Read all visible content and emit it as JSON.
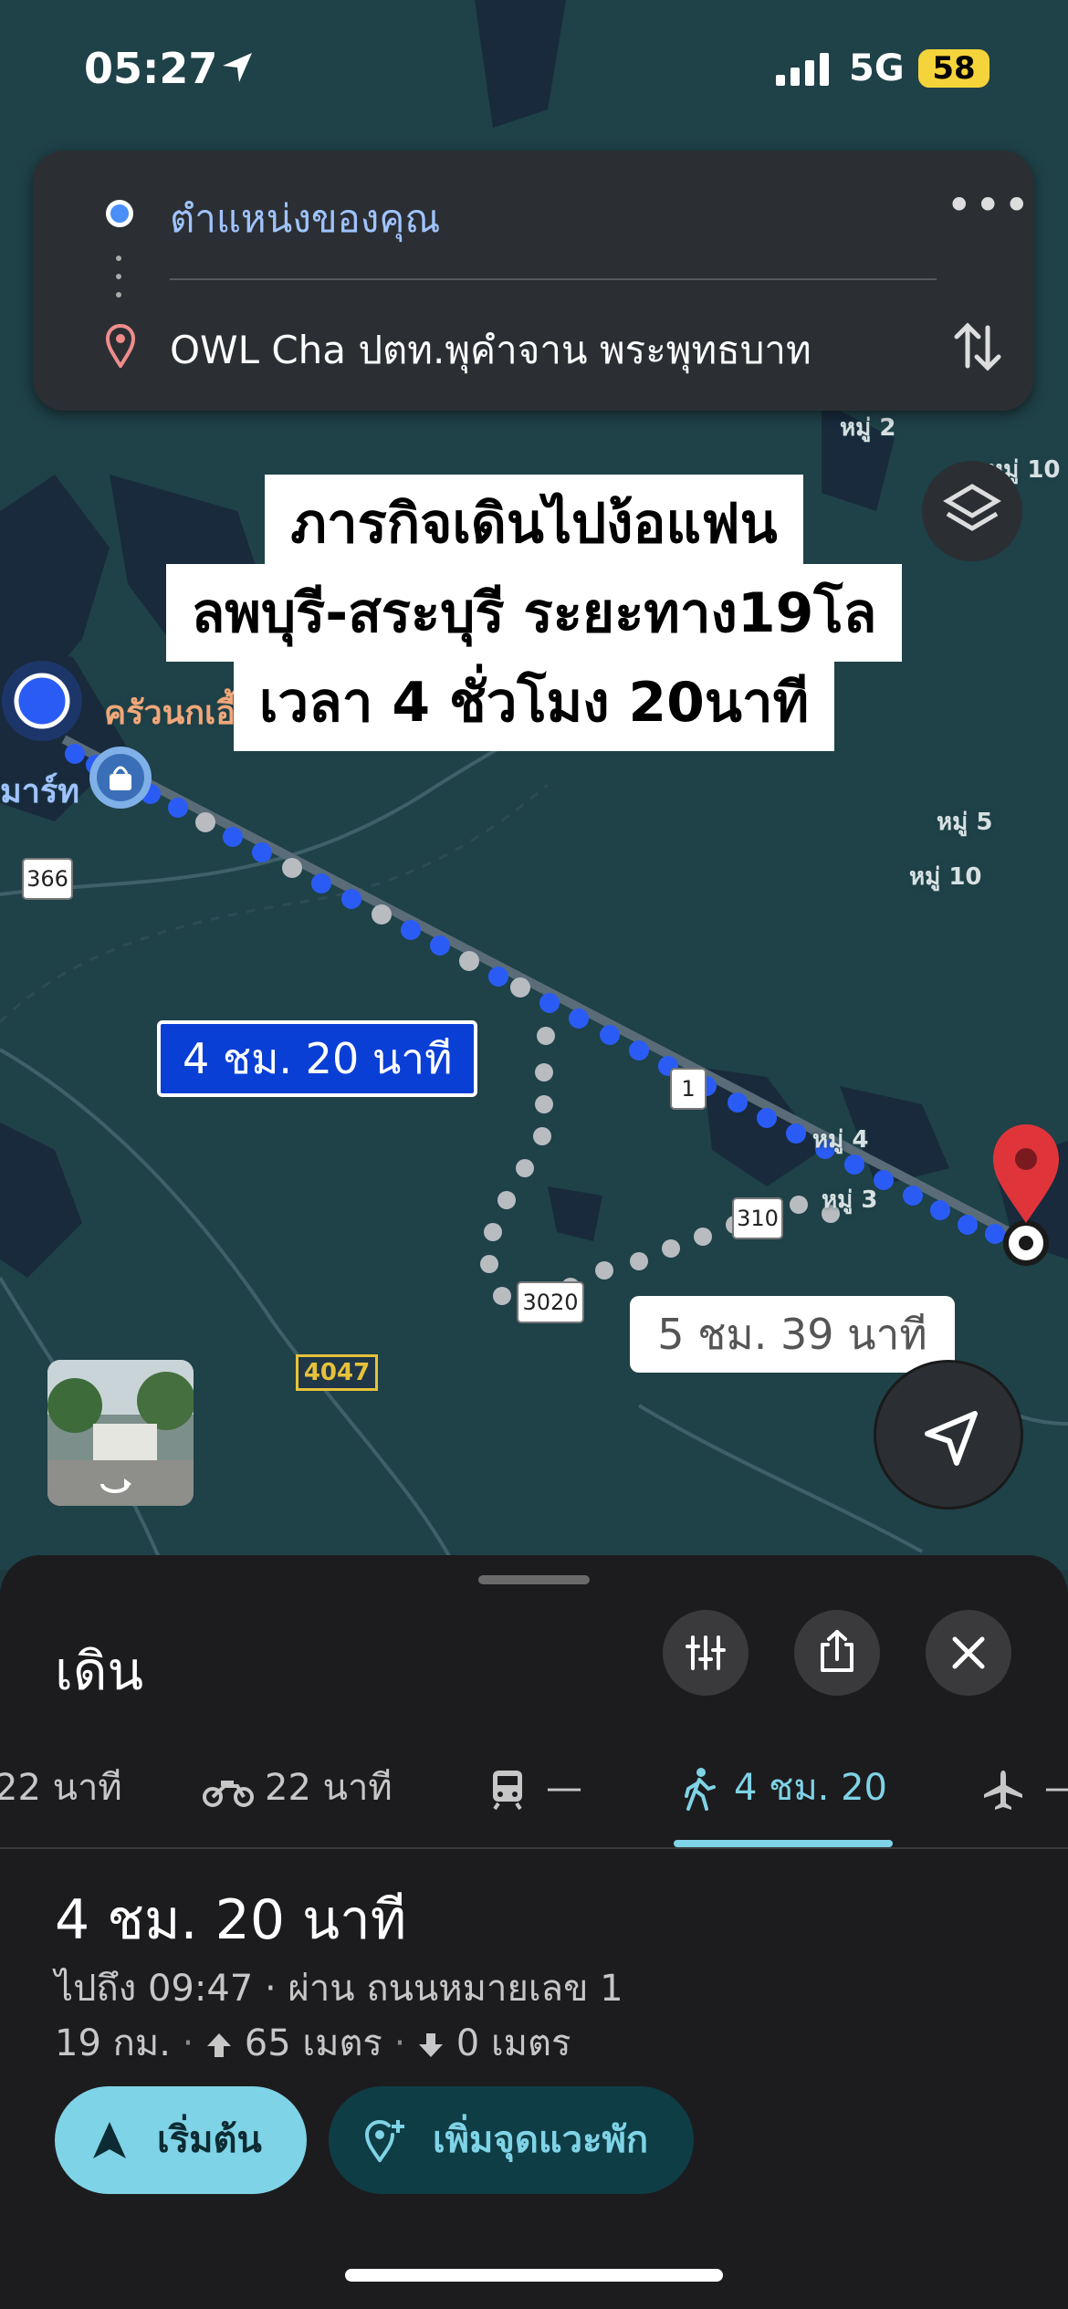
{
  "status_bar": {
    "time": "05:27",
    "network": "5G",
    "battery": "58"
  },
  "route_card": {
    "origin": "ตำแหน่งของคุณ",
    "destination": "OWL Cha ปตท.พุคำจาน พระพุทธบาท",
    "more_icon": "more-horizontal-icon",
    "swap_icon": "swap-vertical-icon"
  },
  "caption": {
    "line1": "ภารกิจเดินไปง้อแฟน",
    "line2": "ลพบุรี-สระบุรี ระยะทาง19โล",
    "line3": "เวลา 4 ชั่วโมง 20นาที"
  },
  "map": {
    "labels": {
      "place1": "ครัวนกเอี้ย",
      "place2": "มาร์ท",
      "moo2": "หมู่ 2",
      "moo10_top": "หมู่ 10",
      "moo5": "หมู่ 5",
      "moo10": "หมู่ 10",
      "moo4": "หมู่ 4",
      "moo3": "หมู่ 3"
    },
    "route_time_primary": "4 ชม. 20 นาที",
    "route_time_alt": "5 ชม. 39 นาที",
    "roads": {
      "r366": "366",
      "r1": "1",
      "r310": "310",
      "r3020": "3020",
      "r4047": "4047"
    },
    "colors": {
      "primary_route": "#2a5cf5",
      "alt_route": "#b8bcc0",
      "destination_pin": "#e0343b"
    }
  },
  "sheet": {
    "mode_title": "เดิน",
    "tabs": [
      {
        "label": "22 นาที",
        "icon": "car-icon"
      },
      {
        "label": "22 นาที",
        "icon": "motorcycle-icon"
      },
      {
        "label": "—",
        "icon": "transit-icon"
      },
      {
        "label": "4 ชม. 20",
        "icon": "walk-icon",
        "active": true
      },
      {
        "label": "—",
        "icon": "airplane-icon"
      }
    ],
    "duration": "4 ชม. 20 นาที",
    "arrive": "ไปถึง 09:47 · ผ่าน ถนนหมายเลข 1",
    "distance": "19 กม.",
    "ascent": "65 เมตร",
    "descent": "0 เมตร",
    "start_label": "เริ่มต้น",
    "add_stop_label": "เพิ่มจุดแวะพัก",
    "accent": "#7fd3e6"
  }
}
